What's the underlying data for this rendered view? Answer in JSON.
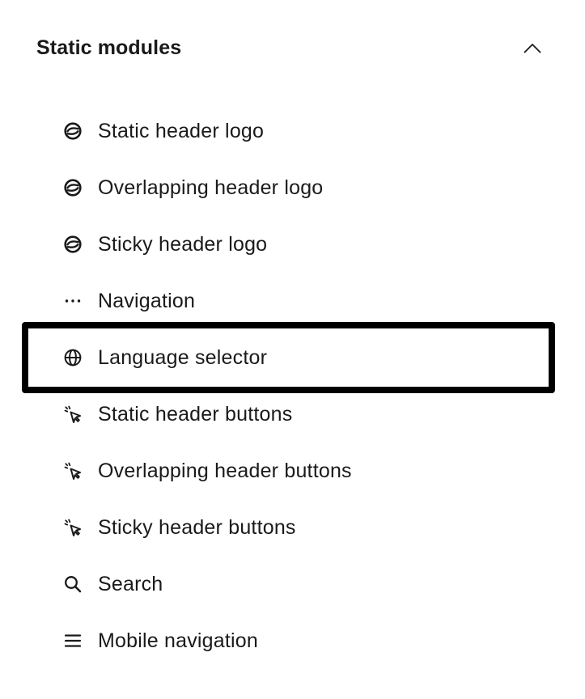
{
  "section": {
    "title": "Static modules",
    "expanded": true
  },
  "modules": [
    {
      "label": "Static header logo",
      "icon": "logo-icon"
    },
    {
      "label": "Overlapping header logo",
      "icon": "logo-icon"
    },
    {
      "label": "Sticky header logo",
      "icon": "logo-icon"
    },
    {
      "label": "Navigation",
      "icon": "ellipsis-icon"
    },
    {
      "label": "Language selector",
      "icon": "globe-icon",
      "selected": true
    },
    {
      "label": "Static header buttons",
      "icon": "cursor-click-icon"
    },
    {
      "label": "Overlapping header buttons",
      "icon": "cursor-click-icon"
    },
    {
      "label": "Sticky header buttons",
      "icon": "cursor-click-icon"
    },
    {
      "label": "Search",
      "icon": "search-icon"
    },
    {
      "label": "Mobile navigation",
      "icon": "menu-icon"
    }
  ],
  "colors": {
    "text": "#1a1a1a",
    "selection_border": "#000000",
    "background": "#ffffff"
  }
}
